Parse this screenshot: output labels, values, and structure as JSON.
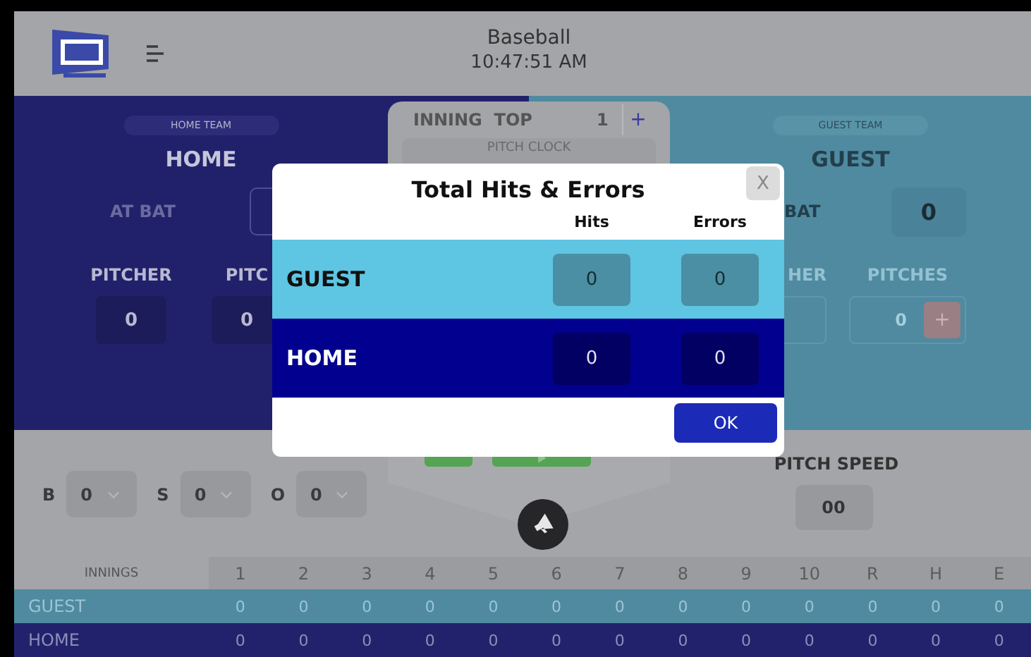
{
  "header": {
    "title": "Baseball",
    "time": "10:47:51 AM"
  },
  "home_team": {
    "label": "HOME TEAM",
    "name": "HOME",
    "at_bat_label": "AT BAT",
    "stats": [
      {
        "label": "PITCHER",
        "value": "0"
      },
      {
        "label": "PITC",
        "value": "0"
      }
    ]
  },
  "inning": {
    "label": "INNING",
    "half": "TOP",
    "number": "1",
    "plus": "+",
    "pitch_clock_label": "PITCH CLOCK"
  },
  "guest_team": {
    "label": "GUEST TEAM",
    "name": "GUEST",
    "at_bat_label": "BAT",
    "at_bat_value": "0",
    "stats": [
      {
        "label": "HER"
      },
      {
        "label": "PITCHES",
        "value": "0",
        "plus": "+"
      }
    ]
  },
  "counts": [
    {
      "label": "B",
      "value": "0"
    },
    {
      "label": "S",
      "value": "0"
    },
    {
      "label": "O",
      "value": "0"
    }
  ],
  "pitch_speed": {
    "label": "PITCH SPEED",
    "value": "00"
  },
  "innings_table": {
    "header_label": "INNINGS",
    "columns": [
      "1",
      "2",
      "3",
      "4",
      "5",
      "6",
      "7",
      "8",
      "9",
      "10",
      "R",
      "H",
      "E"
    ],
    "rows": [
      {
        "team": "GUEST",
        "kind": "guest",
        "values": [
          "0",
          "0",
          "0",
          "0",
          "0",
          "0",
          "0",
          "0",
          "0",
          "0",
          "0",
          "0",
          "0"
        ]
      },
      {
        "team": "HOME",
        "kind": "home",
        "values": [
          "0",
          "0",
          "0",
          "0",
          "0",
          "0",
          "0",
          "0",
          "0",
          "0",
          "0",
          "0",
          "0"
        ]
      }
    ]
  },
  "dialog": {
    "title": "Total Hits & Errors",
    "close": "X",
    "columns": [
      "Hits",
      "Errors"
    ],
    "rows": [
      {
        "team": "GUEST",
        "kind": "guest",
        "hits": "0",
        "errors": "0"
      },
      {
        "team": "HOME",
        "kind": "home",
        "hits": "0",
        "errors": "0"
      }
    ],
    "ok": "OK"
  }
}
